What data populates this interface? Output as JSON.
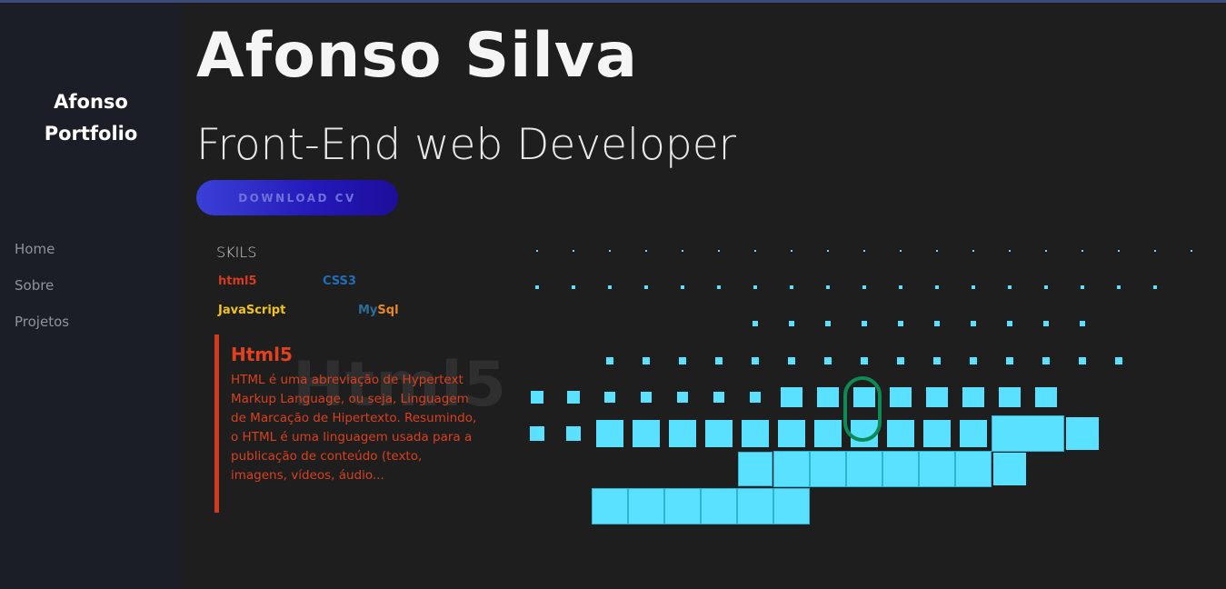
{
  "sidebar": {
    "brand_line1": "Afonso",
    "brand_line2": "Portfolio",
    "nav": [
      "Home",
      "Sobre",
      "Projetos"
    ]
  },
  "hero": {
    "name": "Afonso Silva",
    "role": "Front-End web Developer",
    "cta": "DOWNLOAD CV"
  },
  "skills": {
    "title": "SKILS",
    "items": [
      {
        "label": "html5",
        "color": "#d83a1e"
      },
      {
        "label": "CSS3",
        "color": "#1f6fb8"
      },
      {
        "label": "JavaScript",
        "color": "#f0c419"
      },
      {
        "label_part1": "My",
        "label_part2": "Sql",
        "color1": "#2b6d9c",
        "color2": "#e8891c"
      }
    ],
    "detail": {
      "watermark": "Html5",
      "title": "Html5",
      "text": "HTML é uma abreviação de Hypertext Markup Language, ou seja, Linguagem de Marcação de Hipertexto. Resumindo, o HTML é uma linguagem usada para a publicação de conteúdo (texto, imagens, vídeos, áudio..."
    }
  },
  "colors": {
    "background": "#1e1e1e",
    "sidebar": "#1b1e26",
    "accent_cyan": "#5ae1ff",
    "accent_red": "#d23a1d",
    "button_gradient_start": "#3a40d6",
    "button_gradient_end": "#1d0e9a",
    "pill_green": "#0d8a55"
  }
}
